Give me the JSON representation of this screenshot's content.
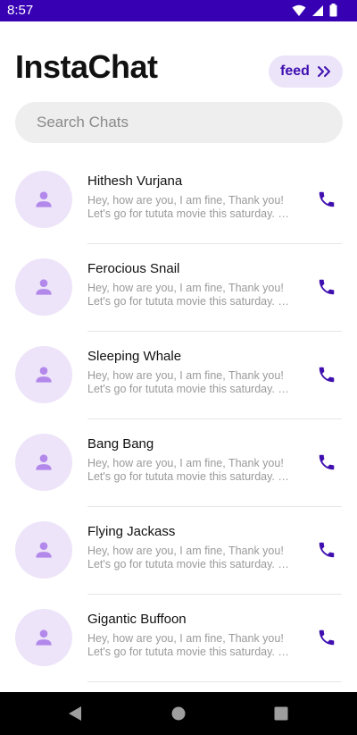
{
  "status_bar": {
    "time": "8:57"
  },
  "header": {
    "title": "InstaChat",
    "feed_label": "feed"
  },
  "search": {
    "placeholder": "Search Chats"
  },
  "chats": [
    {
      "name": "Hithesh Vurjana",
      "preview_line1": "Hey, how are you, I am fine, Thank you!",
      "preview_line2": "Let's go for tututa movie this saturday. I …"
    },
    {
      "name": "Ferocious Snail",
      "preview_line1": "Hey, how are you, I am fine, Thank you!",
      "preview_line2": "Let's go for tututa movie this saturday. I …"
    },
    {
      "name": "Sleeping Whale",
      "preview_line1": "Hey, how are you, I am fine, Thank you!",
      "preview_line2": "Let's go for tututa movie this saturday. I …"
    },
    {
      "name": "Bang Bang",
      "preview_line1": "Hey, how are you, I am fine, Thank you!",
      "preview_line2": "Let's go for tututa movie this saturday. I …"
    },
    {
      "name": "Flying Jackass",
      "preview_line1": "Hey, how are you, I am fine, Thank you!",
      "preview_line2": "Let's go for tututa movie this saturday. I …"
    },
    {
      "name": "Gigantic Buffoon",
      "preview_line1": "Hey, how are you, I am fine, Thank you!",
      "preview_line2": "Let's go for tututa movie this saturday. I …"
    }
  ],
  "icons": {
    "feed": "double-chevron-right-icon",
    "avatar": "person-icon",
    "call": "phone-icon",
    "nav_back": "back-triangle-icon",
    "nav_home": "home-circle-icon",
    "nav_recents": "recents-square-icon"
  },
  "colors": {
    "status_bar": "#3700b3",
    "accent": "#3f0fb0",
    "avatar_bg": "#ede4f9",
    "avatar_icon": "#b388eb",
    "feed_bg": "#ece4f9",
    "search_bg": "#eeeeee"
  }
}
